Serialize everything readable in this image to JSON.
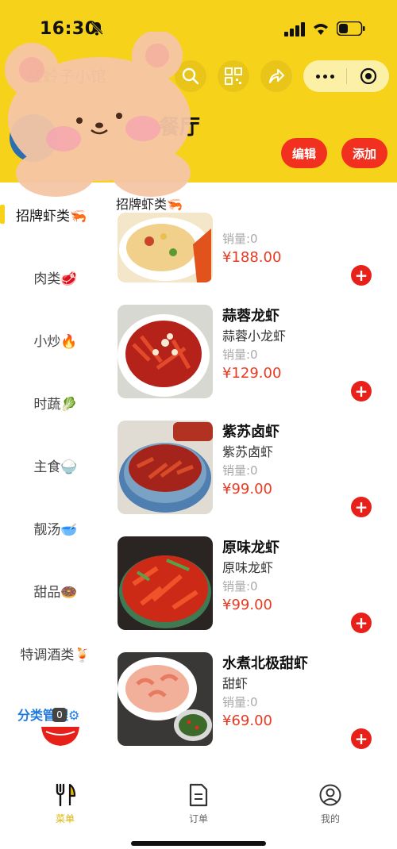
{
  "status": {
    "time": "16:30"
  },
  "header": {
    "store_title": "红蛉子小馆",
    "store_name": "餐厅",
    "edit_label": "编辑",
    "add_label": "添加",
    "accent": "#f7d21a"
  },
  "sidebar": {
    "categories": [
      {
        "label": "招牌虾类🦐"
      },
      {
        "label": "肉类🥩"
      },
      {
        "label": "小炒🔥"
      },
      {
        "label": "时蔬🥬"
      },
      {
        "label": "主食🍚"
      },
      {
        "label": "靓汤🥣"
      },
      {
        "label": "甜品🍩"
      },
      {
        "label": "特调酒类🍹"
      }
    ],
    "manage_label": "分类管理⚙",
    "cart_count": "0"
  },
  "menu": {
    "section_title": "招牌虾类🦐",
    "items": [
      {
        "name": "",
        "desc": "",
        "sales": "销量:0",
        "price": "¥188.00"
      },
      {
        "name": "蒜蓉龙虾",
        "desc": "蒜蓉小龙虾",
        "sales": "销量:0",
        "price": "¥129.00"
      },
      {
        "name": "紫苏卤虾",
        "desc": "紫苏卤虾",
        "sales": "销量:0",
        "price": "¥99.00"
      },
      {
        "name": "原味龙虾",
        "desc": "原味龙虾",
        "sales": "销量:0",
        "price": "¥99.00"
      },
      {
        "name": "水煮北极甜虾",
        "desc": "甜虾",
        "sales": "销量:0",
        "price": "¥69.00"
      }
    ]
  },
  "tabbar": {
    "tabs": [
      {
        "label": "菜单",
        "icon": "fork-knife-icon"
      },
      {
        "label": "订单",
        "icon": "document-icon"
      },
      {
        "label": "我的",
        "icon": "user-icon"
      }
    ]
  }
}
